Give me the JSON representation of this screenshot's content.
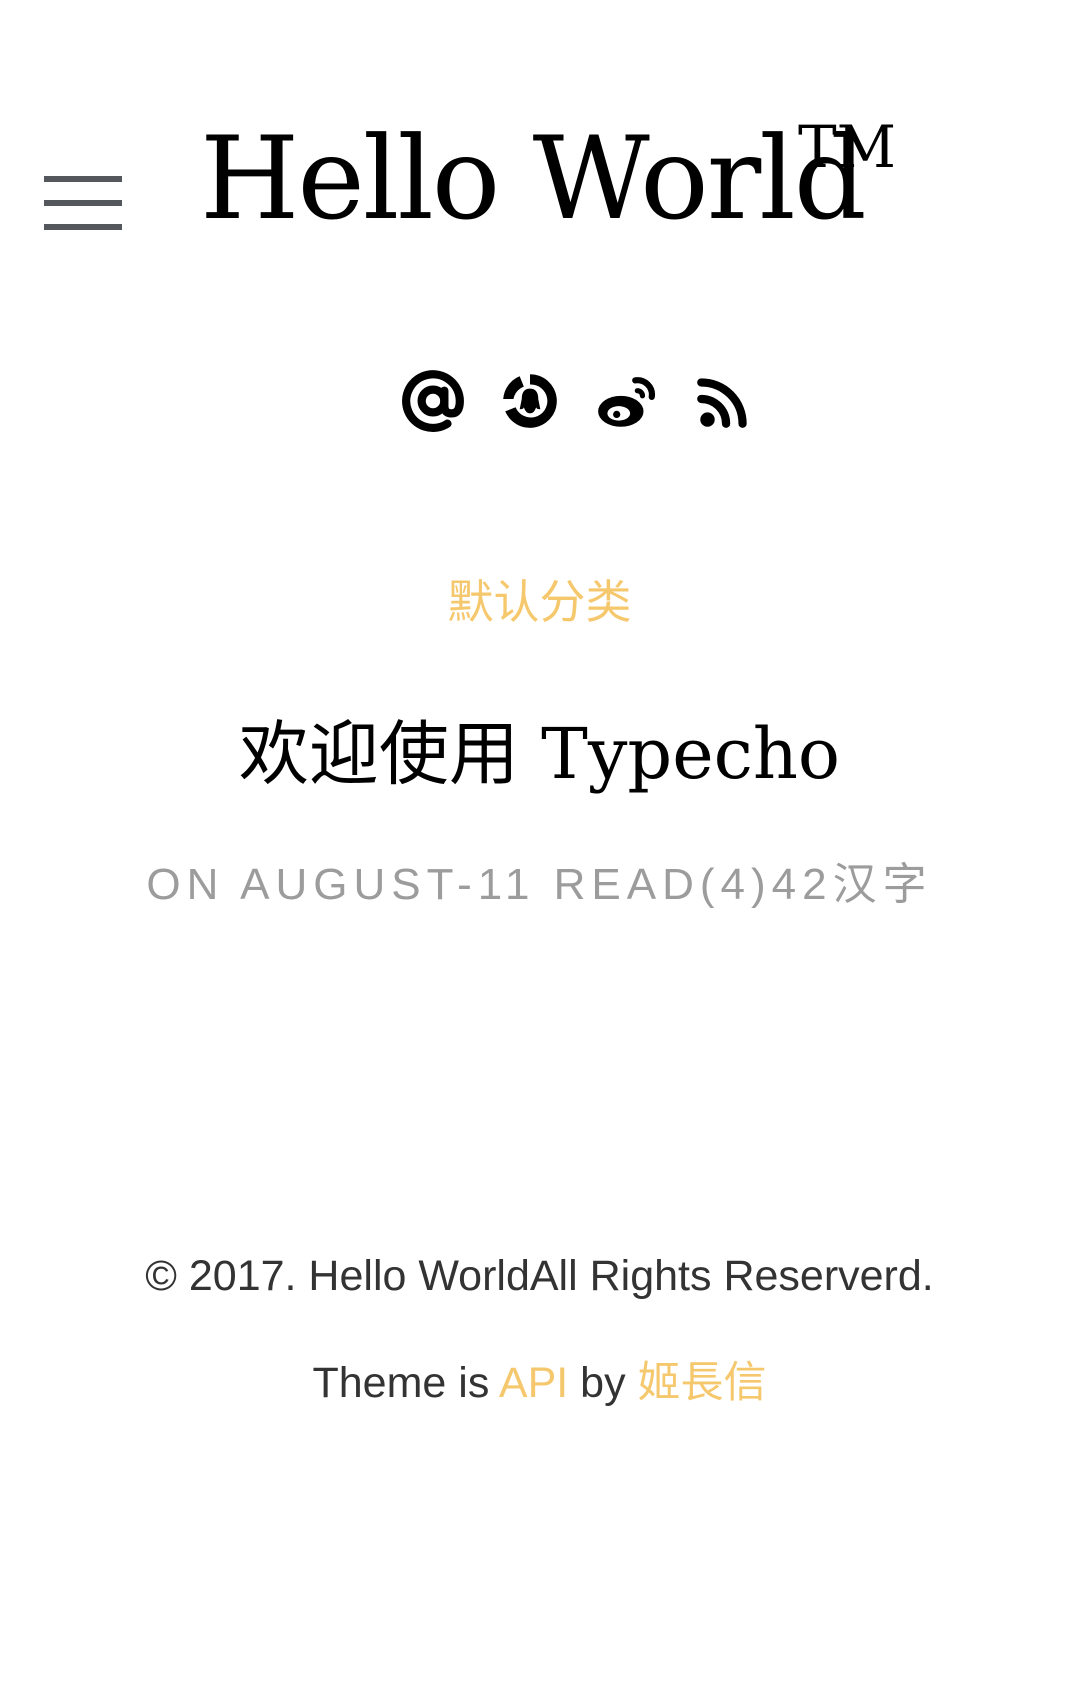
{
  "header": {
    "menu_icon": "hamburger-menu-icon",
    "site_title": "Hello World",
    "trademark": "TM"
  },
  "social_links": [
    {
      "icon": "at-email-icon"
    },
    {
      "icon": "qq-icon"
    },
    {
      "icon": "weibo-icon"
    },
    {
      "icon": "rss-icon"
    }
  ],
  "post": {
    "category": "默认分类",
    "title": "欢迎使用 Typecho",
    "meta": "ON AUGUST-11 READ(4)42汉字"
  },
  "footer": {
    "copyright": "© 2017. Hello WorldAll Rights Reserverd.",
    "theme_prefix": "Theme is ",
    "theme_name": "API",
    "by_text": " by ",
    "author": "姬長信"
  },
  "colors": {
    "accent": "#f6c86e",
    "menu_icon": "#54575c",
    "meta_text": "#9c9c9c"
  }
}
